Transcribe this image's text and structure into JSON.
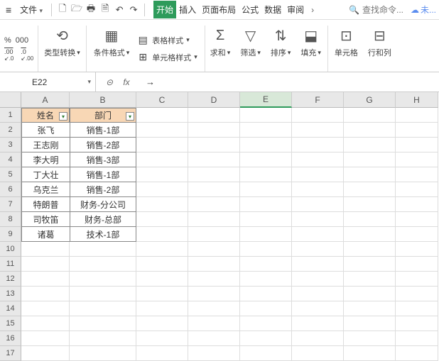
{
  "menubar": {
    "file_label": "文件",
    "tabs": [
      "开始",
      "插入",
      "页面布局",
      "公式",
      "数据",
      "审阅"
    ],
    "active_tab": 0,
    "search_placeholder": "查找命令...",
    "cloud_label": "未..."
  },
  "ribbon": {
    "numfmt_left": "%",
    "numfmt_right": "000",
    "dec_inc": ".00",
    "dec_inc_sub": ".0",
    "dec_dec": ".0",
    "dec_dec_sub": ".00",
    "type_convert_label": "类型转换",
    "cond_format_label": "条件格式",
    "table_style_label": "表格样式",
    "cell_style_label": "单元格样式",
    "sum_label": "求和",
    "filter_label": "筛选",
    "sort_label": "排序",
    "fill_label": "填充",
    "cells_label": "单元格",
    "rowcol_label": "行和列"
  },
  "fxbar": {
    "namebox": "E22",
    "formula": "→"
  },
  "grid": {
    "col_letters": [
      "A",
      "B",
      "C",
      "D",
      "E",
      "F",
      "G",
      "H"
    ],
    "selected_col": "E",
    "row_numbers": [
      1,
      2,
      3,
      4,
      5,
      6,
      7,
      8,
      9,
      10,
      11,
      12,
      13,
      14,
      15,
      16,
      17
    ],
    "headers": {
      "A": "姓名",
      "B": "部门"
    },
    "data": [
      {
        "A": "张飞",
        "B": "销售-1部"
      },
      {
        "A": "王志刚",
        "B": "销售-2部"
      },
      {
        "A": "李大明",
        "B": "销售-3部"
      },
      {
        "A": "丁大壮",
        "B": "销售-1部"
      },
      {
        "A": "乌克兰",
        "B": "销售-2部"
      },
      {
        "A": "特朗普",
        "B": "财务-分公司"
      },
      {
        "A": "司牧笛",
        "B": "财务-总部"
      },
      {
        "A": "诸葛",
        "B": "技术-1部"
      }
    ]
  }
}
